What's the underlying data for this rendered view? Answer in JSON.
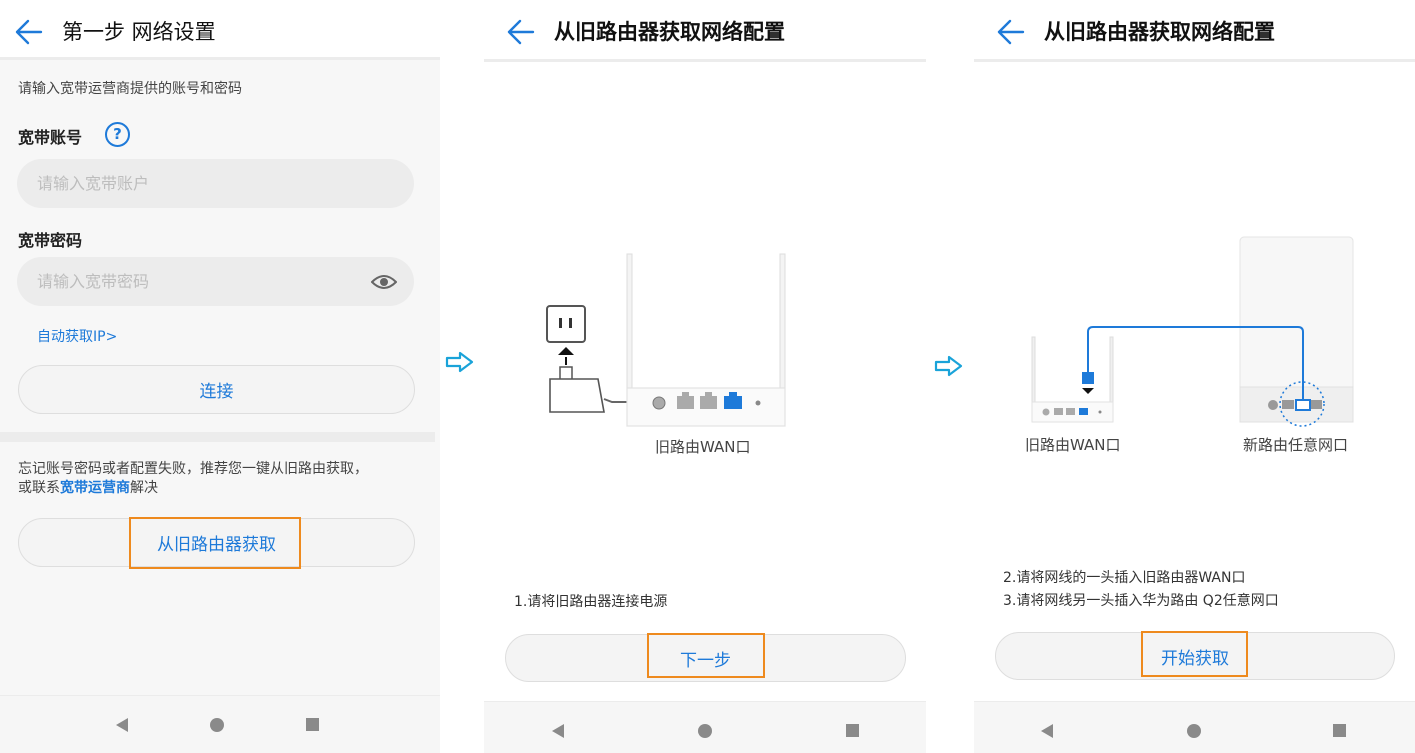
{
  "screens": [
    {
      "title": "第一步 网络设置",
      "hint": "请输入宽带运营商提供的账号和密码",
      "account_label": "宽带账号",
      "account_placeholder": "请输入宽带账户",
      "password_label": "宽带密码",
      "password_placeholder": "请输入宽带密码",
      "auto_ip_link": "自动获取IP>",
      "connect_button": "连接",
      "forgot_text": "忘记账号密码或者配置失败，推荐您一键从旧路由获取，",
      "forgot_text_2_prefix": "或联系",
      "forgot_link": "宽带运营商",
      "forgot_text_2_suffix": "解决",
      "get_from_old_button": "从旧路由器获取"
    },
    {
      "title": "从旧路由器获取网络配置",
      "router_caption": "旧路由WAN口",
      "step_text": "1.请将旧路由器连接电源",
      "next_button": "下一步"
    },
    {
      "title": "从旧路由器获取网络配置",
      "old_router_caption": "旧路由WAN口",
      "new_router_caption": "新路由任意网口",
      "step_2": "2.请将网线的一头插入旧路由器WAN口",
      "step_3": "3.请将网线另一头插入华为路由 Q2任意网口",
      "start_button": "开始获取"
    }
  ],
  "colors": {
    "accent": "#1e7ad9",
    "highlight": "#ee8a1e",
    "arrow": "#1aa3d9"
  },
  "icons": [
    "back-arrow-icon",
    "help-icon",
    "eye-icon",
    "nav-back-icon",
    "nav-home-icon",
    "nav-recent-icon",
    "flow-arrow-icon"
  ]
}
